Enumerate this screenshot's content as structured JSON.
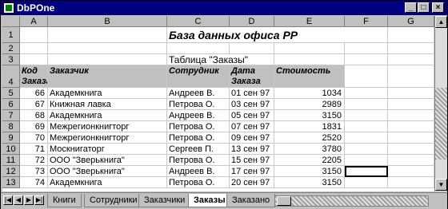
{
  "window": {
    "title": "DbPOne"
  },
  "controls": {
    "minimize": "_",
    "maximize": "□",
    "close": "×"
  },
  "columns": [
    "A",
    "B",
    "C",
    "D",
    "E",
    "F",
    "G"
  ],
  "rows": [
    "1",
    "2",
    "3",
    "4",
    "5",
    "6",
    "7",
    "8",
    "9",
    "10",
    "11",
    "12",
    "13"
  ],
  "sheet_title": "База данных офиса PP",
  "table_title": "Таблица \"Заказы\"",
  "headers": {
    "code": "Код Заказа",
    "customer": "Заказчик",
    "employee": "Сотрудник",
    "date": "Дата Заказа",
    "cost": "Стоимость"
  },
  "data_rows": [
    {
      "code": "66",
      "customer": "Академкнига",
      "employee": "Андреев В.",
      "date": "01 сен 97",
      "cost": "1034"
    },
    {
      "code": "67",
      "customer": "Книжная лавка",
      "employee": "Петрова О.",
      "date": "03 сен 97",
      "cost": "2989"
    },
    {
      "code": "68",
      "customer": "Академкнига",
      "employee": "Андреев В.",
      "date": "05 сен 97",
      "cost": "3150"
    },
    {
      "code": "69",
      "customer": "Межрегионкнигторг",
      "employee": "Петрова О.",
      "date": "07 сен 97",
      "cost": "1831"
    },
    {
      "code": "70",
      "customer": "Межрегионкнигторг",
      "employee": "Петрова О.",
      "date": "09 сен 97",
      "cost": "2520"
    },
    {
      "code": "71",
      "customer": "Москнигаторг",
      "employee": "Сергеев П.",
      "date": "13 сен 97",
      "cost": "3780"
    },
    {
      "code": "72",
      "customer": "ООО \"Зверькнига\"",
      "employee": "Петрова О.",
      "date": "15 сен 97",
      "cost": "2205"
    },
    {
      "code": "73",
      "customer": "ООО \"Зверькнига\"",
      "employee": "Андреев В.",
      "date": "17 сен 97",
      "cost": "3150"
    },
    {
      "code": "74",
      "customer": "Академкнига",
      "employee": "Петрова О.",
      "date": "20 сен 97",
      "cost": "3150"
    }
  ],
  "tabs": [
    "Книги",
    "Сотрудники",
    "Заказчики",
    "Заказы",
    "Заказано"
  ],
  "active_tab": "Заказы",
  "nav": {
    "first": "|◀",
    "prev": "◀",
    "next": "▶",
    "last": "▶|"
  },
  "scroll": {
    "up": "▲",
    "down": "▼"
  }
}
